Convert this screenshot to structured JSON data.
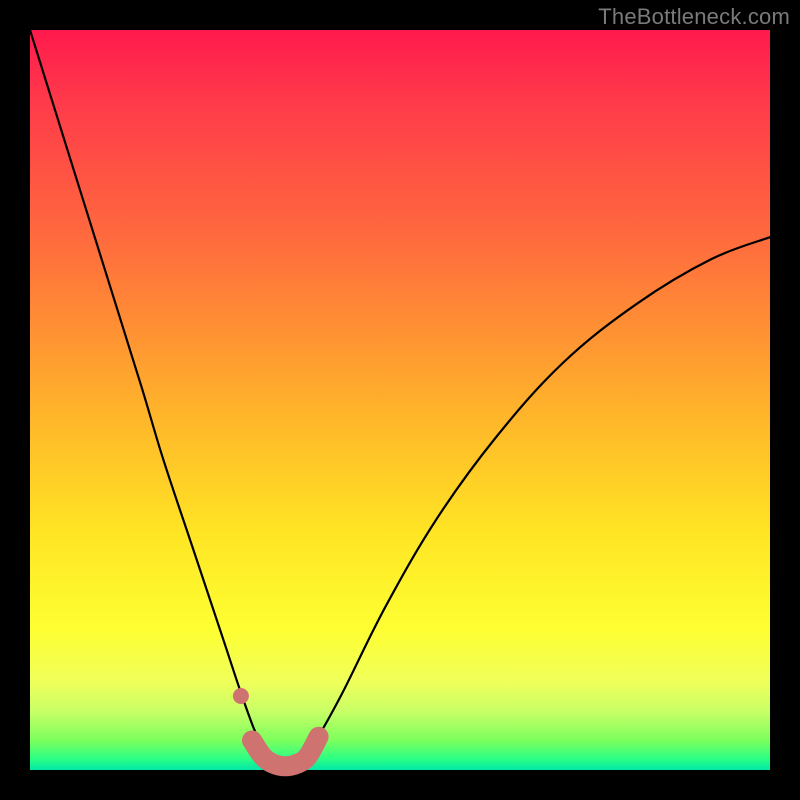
{
  "watermark": "TheBottleneck.com",
  "colors": {
    "frame": "#000000",
    "curve": "#000000",
    "marker": "#cf7370",
    "gradient_stops": [
      "#ff1a4d",
      "#ff6a3e",
      "#ffb52a",
      "#feff32",
      "#7cff5e",
      "#00e7a8"
    ]
  },
  "chart_data": {
    "type": "line",
    "title": "",
    "xlabel": "",
    "ylabel": "",
    "xlim": [
      0,
      100
    ],
    "ylim": [
      0,
      100
    ],
    "annotations": [],
    "series": [
      {
        "name": "bottleneck-curve",
        "x": [
          0,
          5,
          10,
          15,
          18,
          22,
          26,
          29,
          31,
          33,
          34.5,
          36,
          38,
          42,
          48,
          55,
          63,
          72,
          82,
          92,
          100
        ],
        "y": [
          100,
          84,
          68,
          52,
          42,
          30,
          18,
          9,
          4,
          1.5,
          0.5,
          1,
          3,
          10,
          22,
          34,
          45,
          55,
          63,
          69,
          72
        ]
      }
    ],
    "markers": {
      "name": "highlight-band",
      "comment": "thick salmon rounded stroke near the valley bottom",
      "x": [
        28.5,
        30,
        31.5,
        33,
        34.5,
        36,
        37.5,
        39
      ],
      "y": [
        10,
        4,
        1.8,
        0.8,
        0.5,
        0.8,
        1.8,
        4.5
      ]
    }
  }
}
